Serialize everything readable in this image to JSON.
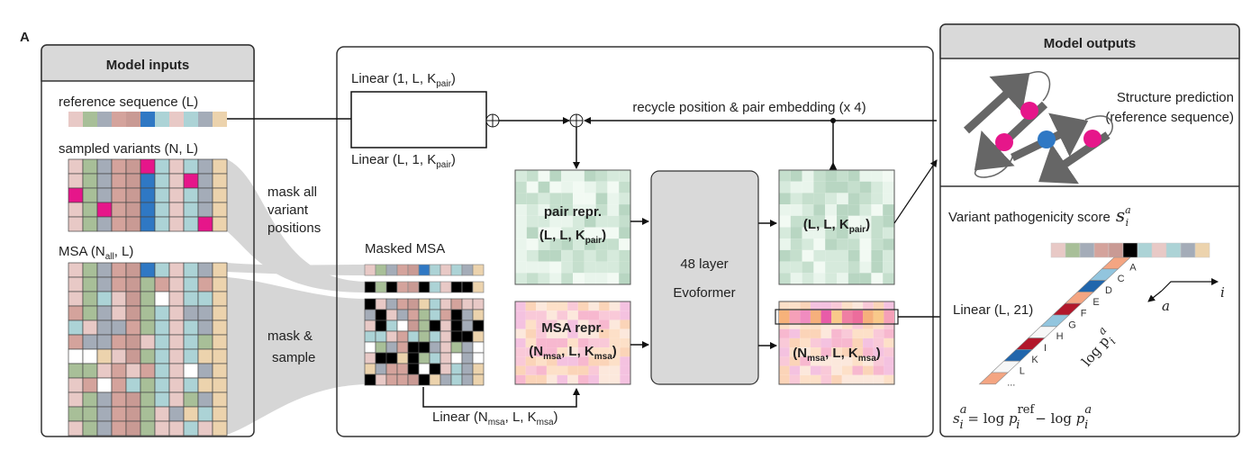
{
  "panel_letter": "A",
  "colors": {
    "pink": "#e8c9c6",
    "green": "#a8bf98",
    "slate": "#a4acb8",
    "rose": "#d4a39c",
    "rose2": "#c99a94",
    "blue": "#2f78c4",
    "lightblue": "#acd3d6",
    "tan": "#ecd3ad",
    "magenta": "#e6168a",
    "mask": "#000000",
    "panel_header": "#d9d9d9",
    "pair": "#d6eadc",
    "msa": "#f9d3c8",
    "evoformer": "#d9d9d9",
    "strand": "#666666"
  },
  "inputs": {
    "title": "Model inputs",
    "reference_label": "reference sequence (L)",
    "variants_label": "sampled variants (N, L)",
    "msa_label": {
      "pre": "MSA (N",
      "sub": "all",
      "post": ", L)"
    }
  },
  "transforms": {
    "mask_variants": [
      "mask all",
      "variant",
      "positions"
    ],
    "mask_sample": [
      "mask &",
      "sample"
    ]
  },
  "model": {
    "linear_1L": {
      "pre": "Linear (1, L, K",
      "sub": "pair",
      "post": ")"
    },
    "linear_L1": {
      "pre": "Linear (L, 1, K",
      "sub": "pair",
      "post": ")"
    },
    "recycle_label": "recycle position & pair embedding (x 4)",
    "masked_msa_label": "Masked MSA",
    "pair_repr": {
      "title": "pair repr.",
      "pre": "(L, L, K",
      "sub": "pair",
      "post": ")"
    },
    "msa_repr": {
      "title": "MSA repr.",
      "pre": "(N",
      "sub1": "msa",
      "mid": ", L, K",
      "sub2": "msa",
      "post": ")"
    },
    "evoformer": [
      "48 layer",
      "Evoformer"
    ],
    "pair_out": {
      "pre": "(L, L, K",
      "sub": "pair",
      "post": ")"
    },
    "msa_out": {
      "pre": "(N",
      "sub1": "msa",
      "mid": ", L, K",
      "sub2": "msa",
      "post": ")"
    },
    "linear_msa": {
      "pre": "Linear (N",
      "sub1": "msa",
      "mid": ", L, K",
      "sub2": "msa",
      "post": ")"
    }
  },
  "outputs": {
    "title": "Model outputs",
    "structure_title": "Structure prediction",
    "structure_subtitle": "(reference sequence)",
    "score_title": "Variant pathogenicity score",
    "linear_21": "Linear (L, 21)",
    "amino_acids": [
      "A",
      "C",
      "D",
      "E",
      "F",
      "G",
      "H",
      "I",
      "K",
      "L",
      "..."
    ],
    "axis_a": "a",
    "axis_i": "i",
    "logp": "log p",
    "formula": {
      "s": "s",
      "eq": " = log ",
      "p": "p",
      "ref": "ref",
      "minus": " − log ",
      "sup_a": "a",
      "sub_i": "i"
    }
  }
}
